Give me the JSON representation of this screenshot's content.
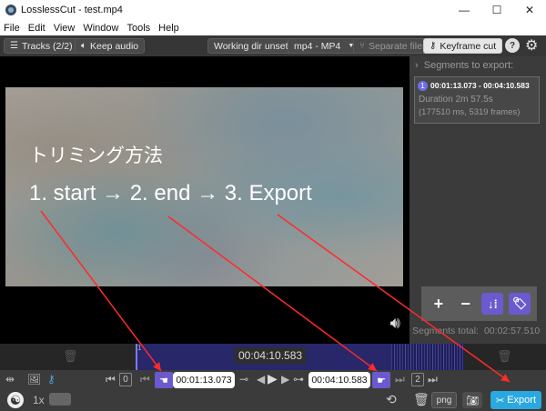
{
  "window": {
    "title": "LosslessCut - test.mp4",
    "controls": {
      "minimize": "—",
      "maximize": "☐",
      "close": "✕"
    }
  },
  "menu": [
    "File",
    "Edit",
    "View",
    "Window",
    "Tools",
    "Help"
  ],
  "toolbar": {
    "tracks_label": "Tracks (2/2)",
    "keep_audio_label": "Keep audio",
    "working_dir_label": "Working dir unset",
    "format_label": "mp4 - MP4",
    "separate_files_label": "Separate files",
    "keyframe_cut_label": "Keyframe cut",
    "help_label": "?"
  },
  "annotation": {
    "title": "トリミング方法",
    "steps": "1. start  → 2. end → 3. Export",
    "arrow_color": "#ff2a2a"
  },
  "segments": {
    "header": "Segments to export:",
    "items": [
      {
        "number": "1",
        "range": "00:01:13.073 - 00:04:10.583",
        "duration": "Duration 2m 57.5s",
        "detail": "(177510 ms, 5319 frames)"
      }
    ],
    "tools": {
      "add": "+",
      "remove": "−",
      "sort": "↓⁞",
      "tag": "🏷"
    },
    "total_label": "Segments total:",
    "total_value": "00:02:57.510"
  },
  "timeline": {
    "current_time": "00:04:10.583",
    "segment_marker_number": "1"
  },
  "controls": {
    "start_time": "00:01:13.073",
    "end_time": "00:04:10.583",
    "left_index": "0",
    "right_index": "2"
  },
  "bottom": {
    "speed_label": "1x",
    "capture_format": "png",
    "export_label": "Export"
  },
  "colors": {
    "accent_purple": "#6a5acd",
    "export_blue": "#2aa8e0",
    "segment_blue": "#27276a"
  }
}
